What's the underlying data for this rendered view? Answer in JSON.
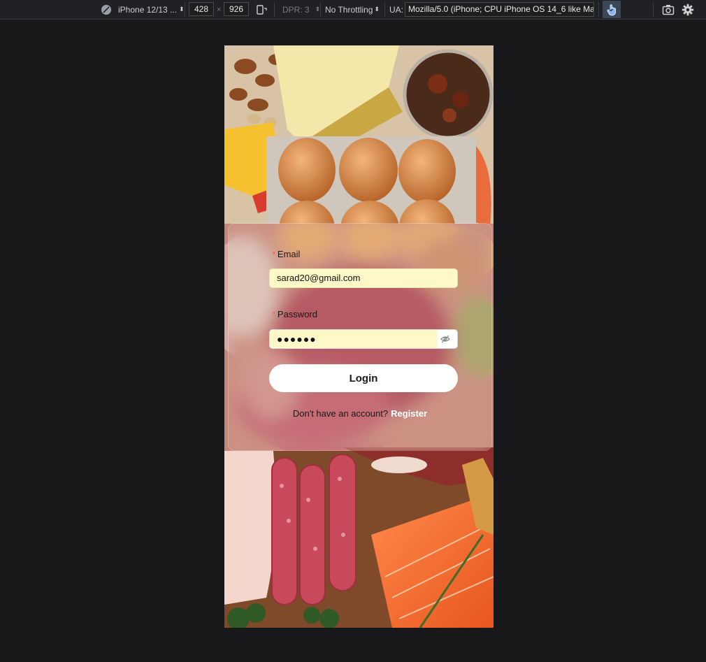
{
  "devtools": {
    "device_name": "iPhone 12/13 ...",
    "width": "428",
    "times": "×",
    "height": "926",
    "dpr_label": "DPR: 3",
    "throttling": "No Throttling",
    "ua_label": "UA:",
    "ua_value": "Mozilla/5.0 (iPhone; CPU iPhone OS 14_6 like Mac",
    "icons": [
      "no-sign-icon",
      "rotate-icon",
      "touch-icon",
      "camera-icon",
      "gear-icon"
    ]
  },
  "login": {
    "email_label": "Email",
    "email_required": "*",
    "email_value": "sarad20@gmail.com",
    "password_label": "Password",
    "password_required": "*",
    "password_value": "●●●●●●",
    "login_button": "Login",
    "register_prompt": "Don't have an account?",
    "register_link": "Register"
  },
  "colors": {
    "input_autofill": "#fdf8c8",
    "button_bg": "#ffffff",
    "register_link": "#ffffff",
    "required_star": "#ff4d4f"
  }
}
